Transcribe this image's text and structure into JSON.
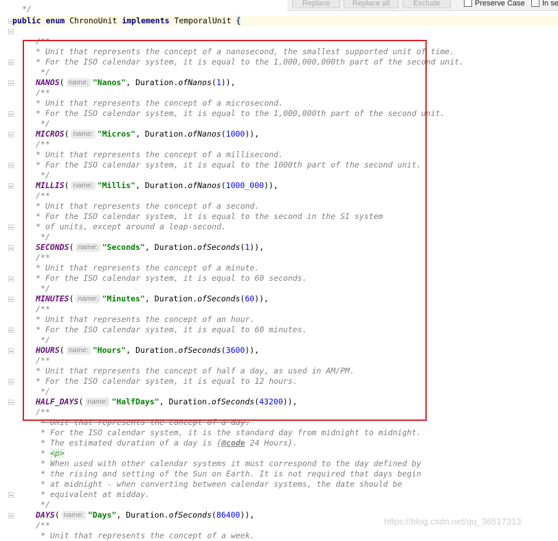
{
  "toolbar": {
    "replace_label": "Replace",
    "replace_all_label": "Replace all",
    "exclude_label": "Exclude",
    "preserve_case_label": "Preserve Case",
    "in_selection_label": "In se"
  },
  "code": {
    "top_fragment": "*/",
    "declaration": {
      "kw1": "public",
      "kw2": "enum",
      "name": "ChronoUnit",
      "kw3": "implements",
      "iface": "TemporalUnit",
      "brace": "{"
    },
    "param_hint": "name:",
    "doc_open": "/**",
    "doc_close": "*/",
    "sections": [
      {
        "doc": [
          "* Unit that represents the concept of a nanosecond, the smallest supported unit of time.",
          "* For the ISO calendar system, it is equal to the 1,000,000,000th part of the second unit."
        ],
        "constant": "NANOS",
        "str": "\"Nanos\"",
        "method": "ofNanos",
        "num": "1"
      },
      {
        "doc": [
          "* Unit that represents the concept of a microsecond.",
          "* For the ISO calendar system, it is equal to the 1,000,000th part of the second unit."
        ],
        "constant": "MICROS",
        "str": "\"Micros\"",
        "method": "ofNanos",
        "num": "1000"
      },
      {
        "doc": [
          "* Unit that represents the concept of a millisecond.",
          "* For the ISO calendar system, it is equal to the 1000th part of the second unit."
        ],
        "constant": "MILLIS",
        "str": "\"Millis\"",
        "method": "ofNanos",
        "num": "1000_000"
      },
      {
        "doc": [
          "* Unit that represents the concept of a second.",
          "* For the ISO calendar system, it is equal to the second in the SI system",
          "* of units, except around a leap-second."
        ],
        "constant": "SECONDS",
        "str": "\"Seconds\"",
        "method": "ofSeconds",
        "num": "1"
      },
      {
        "doc": [
          "* Unit that represents the concept of a minute.",
          "* For the ISO calendar system, it is equal to 60 seconds."
        ],
        "constant": "MINUTES",
        "str": "\"Minutes\"",
        "method": "ofSeconds",
        "num": "60"
      },
      {
        "doc": [
          "* Unit that represents the concept of an hour.",
          "* For the ISO calendar system, it is equal to 60 minutes."
        ],
        "constant": "HOURS",
        "str": "\"Hours\"",
        "method": "ofSeconds",
        "num": "3600"
      },
      {
        "doc": [
          "* Unit that represents the concept of half a day, as used in AM/PM.",
          "* For the ISO calendar system, it is equal to 12 hours."
        ],
        "constant": "HALF_DAYS",
        "str": "\"HalfDays\"",
        "method": "ofSeconds",
        "num": "43200"
      }
    ],
    "days_doc": {
      "line1": "* Unit that represents the concept of a day.",
      "line2": "* For the ISO calendar system, it is the standard day from midnight to midnight.",
      "line3_pre": "* The estimated duration of a day is {",
      "line3_tag": "@code",
      "line3_post": " 24 Hours}.",
      "p_prefix": "* ",
      "p_tag": "<p>",
      "rest": [
        "* When used with other calendar systems it must correspond to the day defined by",
        "* the rising and setting of the Sun on Earth. It is not required that days begin",
        "* at midnight - when converting between calendar systems, the date should be",
        "* equivalent at midday."
      ]
    },
    "days": {
      "constant": "DAYS",
      "str": "\"Days\"",
      "method": "ofSeconds",
      "num": "86400"
    },
    "duration": "Duration",
    "tail_open": "/**",
    "tail_line": "* Unit that represents the concept of a week."
  },
  "watermark": "https://blog.csdn.net/qq_36517313"
}
